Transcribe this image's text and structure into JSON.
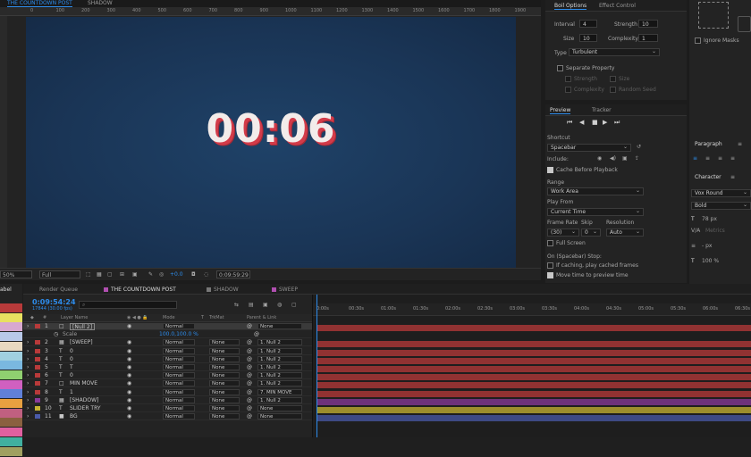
{
  "viewer": {
    "tabs": [
      "THE COUNTDOWN POST",
      "SHADOW"
    ],
    "ruler": [
      "0",
      "100",
      "200",
      "300",
      "400",
      "500",
      "600",
      "700",
      "800",
      "900",
      "1000",
      "1100",
      "1200",
      "1300",
      "1400",
      "1500",
      "1600",
      "1700",
      "1800",
      "1900"
    ],
    "countdown_text": "00:06",
    "zoom": "50%",
    "resolution": "Full",
    "exposure": "+0.0",
    "timecode": "0:09:59:29"
  },
  "effect_controls": {
    "tabs": [
      "Boil Options",
      "Effect Control"
    ],
    "interval_label": "Interval",
    "interval_value": "4",
    "strength_label": "Strength",
    "strength_value": "10",
    "size_label": "Size",
    "size_value": "10",
    "complexity_label": "Complexity",
    "complexity_value": "1",
    "type_label": "Type",
    "type_value": "Turbulent",
    "separate_property": "Separate Property",
    "sub_strength": "Strength",
    "sub_size": "Size",
    "sub_complexity": "Complexity",
    "sub_random_seed": "Random Seed",
    "ignore_masks": "Ignore Masks"
  },
  "preview": {
    "tabs": [
      "Preview",
      "Tracker"
    ],
    "shortcut_label": "Shortcut",
    "shortcut_value": "Spacebar",
    "include_label": "Include:",
    "cache_before_playback": "Cache Before Playback",
    "range_label": "Range",
    "range_value": "Work Area",
    "play_from_label": "Play From",
    "play_from_value": "Current Time",
    "frame_rate_label": "Frame Rate",
    "skip_label": "Skip",
    "resolution_label": "Resolution",
    "frame_rate_value": "(30)",
    "skip_value": "0",
    "resolution_value": "Auto",
    "full_screen": "Full Screen",
    "on_stop_label": "On (Spacebar) Stop:",
    "if_caching": "If caching, play cached frames",
    "move_time": "Move time to preview time"
  },
  "side_panels": {
    "paragraph": "Paragraph",
    "character": "Character",
    "font": "Vox Round",
    "style": "Bold",
    "font_size": "78 px",
    "metrics": "Metrics",
    "px_label": "- px",
    "scale": "100 %"
  },
  "timeline": {
    "label_panel": "abel",
    "tabs": [
      "Render Queue",
      "THE COUNTDOWN POST",
      "SHADOW",
      "SWEEP"
    ],
    "timecode": "0:09:54:24",
    "timecode_sub": "17844 (30.00 fps)",
    "columns": [
      "#",
      "Layer Name",
      "Mode",
      "T",
      "TrkMat",
      "Parent & Link"
    ],
    "ruler": [
      "0:00s",
      "00:30s",
      "01:00s",
      "01:30s",
      "02:00s",
      "02:30s",
      "03:00s",
      "03:30s",
      "04:00s",
      "04:30s",
      "05:00s",
      "05:30s",
      "06:00s",
      "06:30s"
    ],
    "layers": [
      {
        "num": "1",
        "name": "[Null 2]",
        "type": "null",
        "color": "#b83a3a",
        "mode": "Normal",
        "trkmat": "",
        "parent": "None"
      },
      {
        "num": "",
        "name": "Scale",
        "type": "prop",
        "color": "",
        "mode": "",
        "trkmat": "",
        "parent": "",
        "value": "100.0,100.0 %"
      },
      {
        "num": "2",
        "name": "[SWEEP]",
        "type": "comp",
        "color": "#b83a3a",
        "mode": "Normal",
        "trkmat": "None",
        "parent": "1. Null 2"
      },
      {
        "num": "3",
        "name": "0",
        "type": "text",
        "color": "#b83a3a",
        "mode": "Normal",
        "trkmat": "None",
        "parent": "1. Null 2"
      },
      {
        "num": "4",
        "name": "0",
        "type": "text",
        "color": "#b83a3a",
        "mode": "Normal",
        "trkmat": "None",
        "parent": "1. Null 2"
      },
      {
        "num": "5",
        "name": "T",
        "type": "text",
        "color": "#b83a3a",
        "mode": "Normal",
        "trkmat": "None",
        "parent": "1. Null 2"
      },
      {
        "num": "6",
        "name": "0",
        "type": "text",
        "color": "#b83a3a",
        "mode": "Normal",
        "trkmat": "None",
        "parent": "1. Null 2"
      },
      {
        "num": "7",
        "name": "MIN MOVE",
        "type": "null",
        "color": "#b83a3a",
        "mode": "Normal",
        "trkmat": "None",
        "parent": "1. Null 2"
      },
      {
        "num": "8",
        "name": "1",
        "type": "text",
        "color": "#b83a3a",
        "mode": "Normal",
        "trkmat": "None",
        "parent": "7. MIN MOVE"
      },
      {
        "num": "9",
        "name": "[SHADOW]",
        "type": "comp",
        "color": "#8a3a9a",
        "mode": "Normal",
        "trkmat": "None",
        "parent": "1. Null 2"
      },
      {
        "num": "10",
        "name": "SLIDER TRY",
        "type": "text",
        "color": "#c8b432",
        "mode": "Normal",
        "trkmat": "None",
        "parent": "None"
      },
      {
        "num": "11",
        "name": "BG",
        "type": "solid",
        "color": "#4a5aa8",
        "mode": "Normal",
        "trkmat": "None",
        "parent": "None"
      }
    ]
  },
  "label_colors": [
    "#b83a3a",
    "#e8e060",
    "#d8a8d0",
    "#b8c8e8",
    "#e8d8c0",
    "#a0d0e0",
    "#7ab8e0",
    "#90d070",
    "#d060c0",
    "#6080d8",
    "#e8a040",
    "#c06080",
    "#8a6040",
    "#e060a0",
    "#40b0a0",
    "#a0a060"
  ]
}
